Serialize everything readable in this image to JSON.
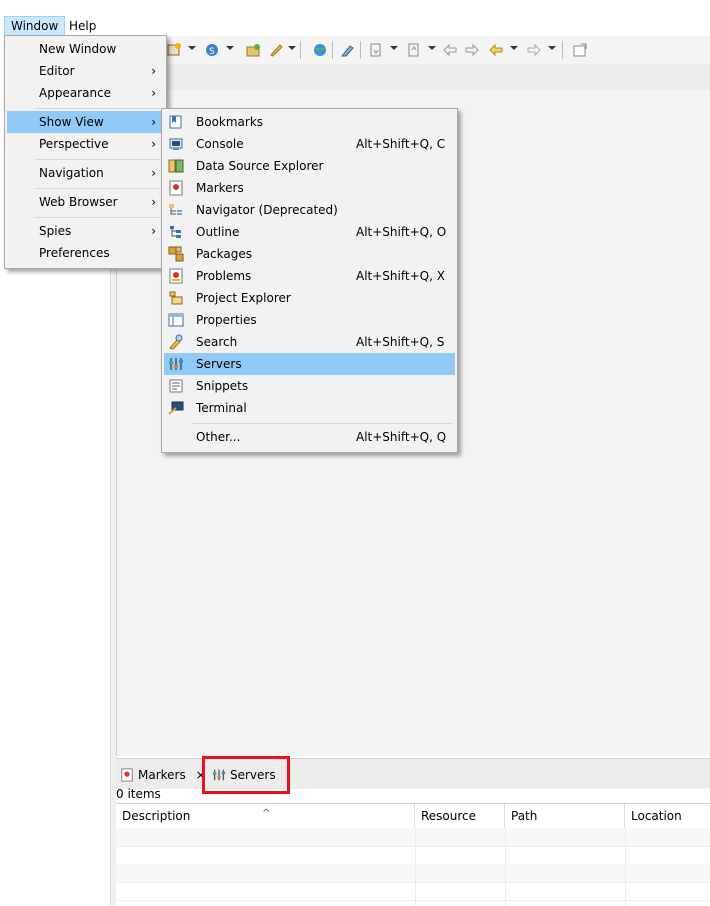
{
  "menubar": {
    "window": "Window",
    "help": "Help"
  },
  "window_menu": {
    "items": [
      {
        "label": "New Window"
      },
      {
        "label": "Editor",
        "submenu": true
      },
      {
        "label": "Appearance",
        "submenu": true
      },
      {
        "label": "Show View",
        "submenu": true,
        "selected": true
      },
      {
        "label": "Perspective",
        "submenu": true
      },
      {
        "label": "Navigation",
        "submenu": true
      },
      {
        "label": "Web Browser",
        "submenu": true
      },
      {
        "label": "Spies",
        "submenu": true
      },
      {
        "label": "Preferences"
      }
    ],
    "arrow": "›"
  },
  "show_view_menu": {
    "items": [
      {
        "label": "Bookmarks",
        "accel": "",
        "icon": "bookmarks-icon"
      },
      {
        "label": "Console",
        "accel": "Alt+Shift+Q, C",
        "icon": "console-icon"
      },
      {
        "label": "Data Source Explorer",
        "accel": "",
        "icon": "data-source-explorer-icon"
      },
      {
        "label": "Markers",
        "accel": "",
        "icon": "markers-icon"
      },
      {
        "label": "Navigator (Deprecated)",
        "accel": "",
        "icon": "navigator-icon"
      },
      {
        "label": "Outline",
        "accel": "Alt+Shift+Q, O",
        "icon": "outline-icon"
      },
      {
        "label": "Packages",
        "accel": "",
        "icon": "packages-icon"
      },
      {
        "label": "Problems",
        "accel": "Alt+Shift+Q, X",
        "icon": "problems-icon"
      },
      {
        "label": "Project Explorer",
        "accel": "",
        "icon": "project-explorer-icon"
      },
      {
        "label": "Properties",
        "accel": "",
        "icon": "properties-icon"
      },
      {
        "label": "Search",
        "accel": "Alt+Shift+Q, S",
        "icon": "search-icon"
      },
      {
        "label": "Servers",
        "accel": "",
        "icon": "servers-icon",
        "selected": true
      },
      {
        "label": "Snippets",
        "accel": "",
        "icon": "snippets-icon"
      },
      {
        "label": "Terminal",
        "accel": "",
        "icon": "terminal-icon"
      },
      {
        "label": "Other...",
        "accel": "Alt+Shift+Q, Q",
        "icon": ""
      }
    ]
  },
  "bottom_panel": {
    "tabs": [
      {
        "label": "Markers",
        "icon": "markers-icon",
        "closable": true
      },
      {
        "label": "Servers",
        "icon": "servers-icon",
        "highlighted": true
      }
    ],
    "close_glyph": "×",
    "items_count": "0 items",
    "sort_indicator": "^",
    "columns": [
      "Description",
      "Resource",
      "Path",
      "Location"
    ]
  },
  "colors": {
    "selection": "#91c9f7",
    "menubar_active": "#cce8ff",
    "highlight_box": "#e8101a"
  }
}
